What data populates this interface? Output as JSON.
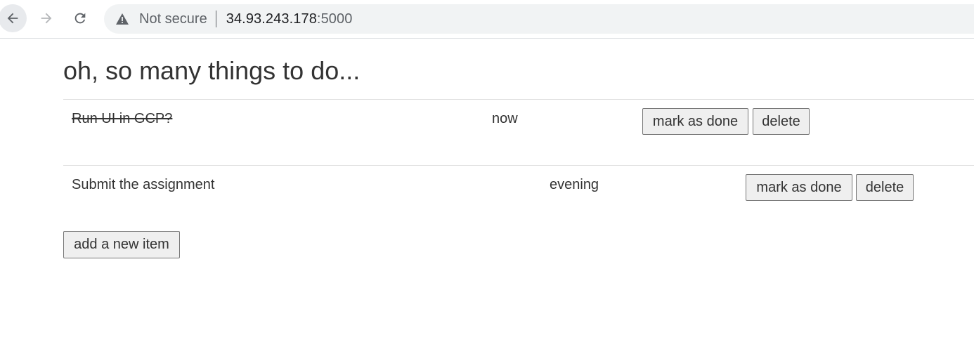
{
  "browser": {
    "security_label": "Not secure",
    "url_host": "34.93.243.178",
    "url_port": ":5000"
  },
  "page": {
    "title": "oh, so many things to do..."
  },
  "todos": [
    {
      "text": "Run UI in GCP?",
      "time": "now",
      "done": true,
      "mark_done_label": "mark as done",
      "delete_label": "delete"
    },
    {
      "text": "Submit the assignment",
      "time": "evening",
      "done": false,
      "mark_done_label": "mark as done",
      "delete_label": "delete"
    }
  ],
  "actions": {
    "add_label": "add a new item"
  }
}
